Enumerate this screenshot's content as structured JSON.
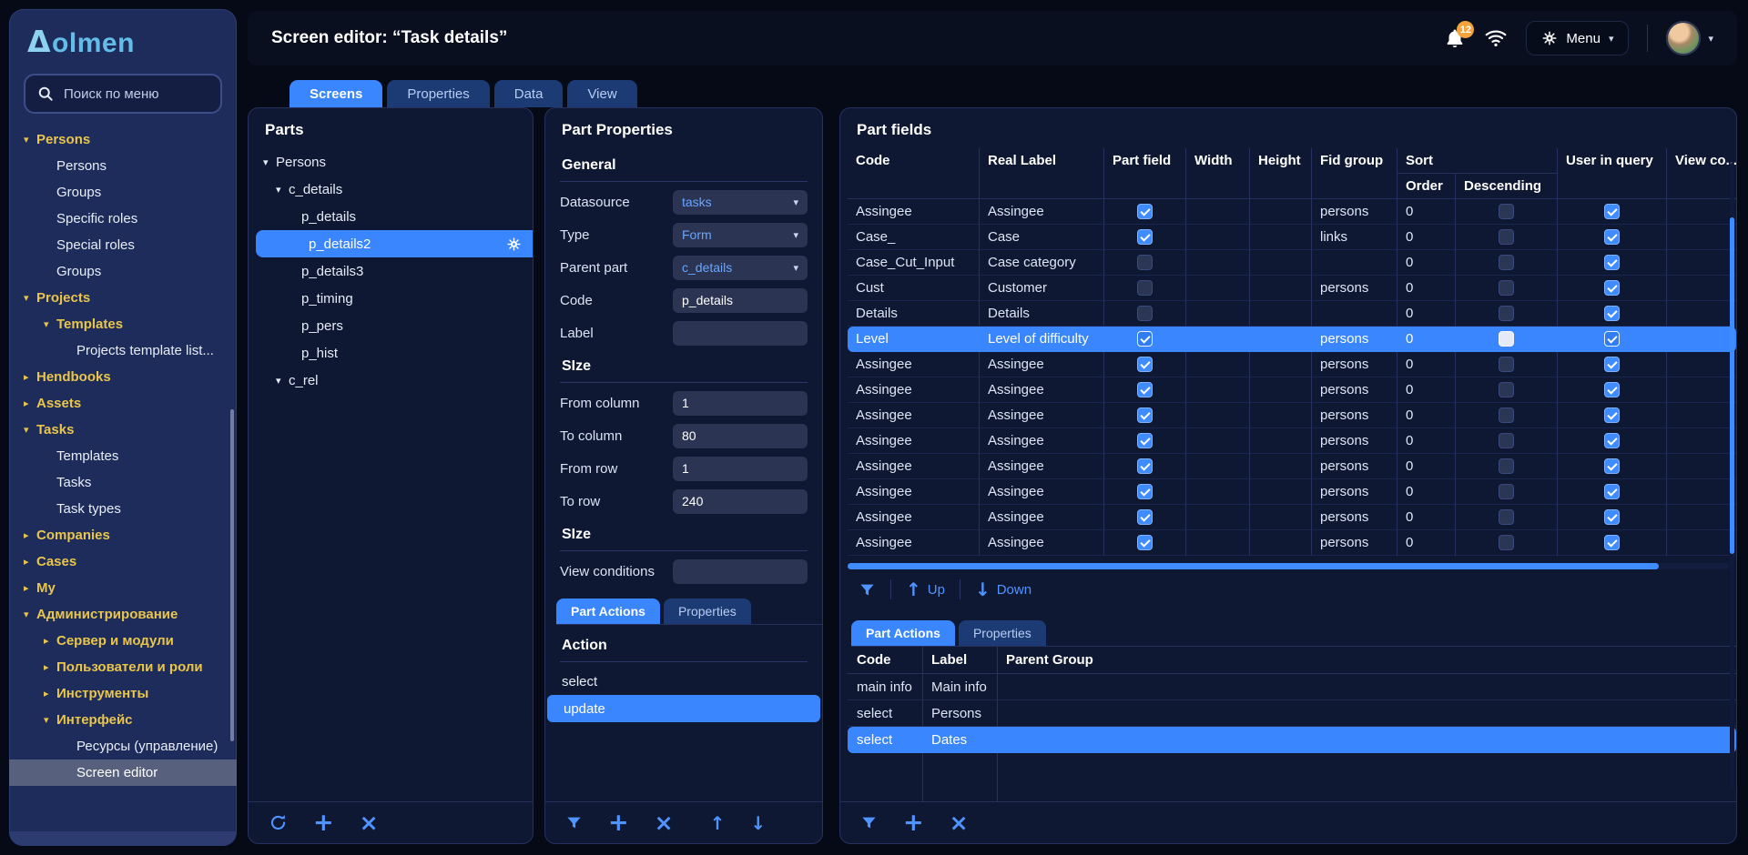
{
  "brand": {
    "delta": "Δ",
    "name": "olmen"
  },
  "icons": {
    "plus": "+",
    "close": "×",
    "up": "↑",
    "down": "↓",
    "dropdown": "▾"
  },
  "sidebar": {
    "search_placeholder": "Поиск по меню",
    "items": [
      {
        "label": "Persons",
        "caret": "▾",
        "gold": true,
        "level": 0
      },
      {
        "label": "Persons",
        "level": 1
      },
      {
        "label": "Groups",
        "level": 1
      },
      {
        "label": "Specific roles",
        "level": 1
      },
      {
        "label": "Special roles",
        "level": 1
      },
      {
        "label": "Groups",
        "level": 1
      },
      {
        "label": "Projects",
        "caret": "▾",
        "gold": true,
        "level": 0
      },
      {
        "label": "Templates",
        "caret": "▾",
        "gold": true,
        "level": 1
      },
      {
        "label": "Projects template list...",
        "level": 2
      },
      {
        "label": "Hendbooks",
        "caret": "▸",
        "gold": true,
        "level": 0
      },
      {
        "label": "Assets",
        "caret": "▸",
        "gold": true,
        "level": 0
      },
      {
        "label": "Tasks",
        "caret": "▾",
        "gold": true,
        "level": 0
      },
      {
        "label": "Templates",
        "level": 1
      },
      {
        "label": "Tasks",
        "level": 1
      },
      {
        "label": "Task types",
        "level": 1
      },
      {
        "label": "Companies",
        "caret": "▸",
        "gold": true,
        "level": 0
      },
      {
        "label": "Cases",
        "caret": "▸",
        "gold": true,
        "level": 0
      },
      {
        "label": "My",
        "caret": "▸",
        "gold": true,
        "level": 0
      },
      {
        "label": "Администрирование",
        "caret": "▾",
        "gold": true,
        "level": 0
      },
      {
        "label": "Сервер и модули",
        "caret": "▸",
        "gold": true,
        "level": 1
      },
      {
        "label": "Пользователи и роли",
        "caret": "▸",
        "gold": true,
        "level": 1
      },
      {
        "label": "Инструменты",
        "caret": "▸",
        "gold": true,
        "level": 1
      },
      {
        "label": "Интерфейс",
        "caret": "▾",
        "gold": true,
        "level": 1
      },
      {
        "label": "Ресурсы (управление)",
        "level": 2
      },
      {
        "label": "Screen editor",
        "level": 2,
        "selected": true
      }
    ]
  },
  "topbar": {
    "title": "Screen editor: “Task details”",
    "badge": "12",
    "menu_label": "Menu"
  },
  "tabs": [
    {
      "label": "Screens",
      "active": true
    },
    {
      "label": "Properties"
    },
    {
      "label": "Data"
    },
    {
      "label": "View"
    }
  ],
  "parts": {
    "title": "Parts",
    "tree": [
      {
        "label": "Persons",
        "caret": "▾",
        "level": 0
      },
      {
        "label": "c_details",
        "caret": "▾",
        "level": 1
      },
      {
        "label": "p_details",
        "level": 2
      },
      {
        "label": "p_details2",
        "level": 2,
        "selected": true,
        "gear": true
      },
      {
        "label": "p_details3",
        "level": 2
      },
      {
        "label": "p_timing",
        "level": 2
      },
      {
        "label": "p_pers",
        "level": 2
      },
      {
        "label": "p_hist",
        "level": 2
      },
      {
        "label": "c_rel",
        "caret": "▾",
        "level": 1
      }
    ]
  },
  "properties": {
    "title": "Part Properties",
    "sections": {
      "general": "General",
      "size1": "SIze",
      "size2": "SIze"
    },
    "fields": {
      "datasource": {
        "label": "Datasource",
        "value": "tasks"
      },
      "type": {
        "label": "Type",
        "value": "Form"
      },
      "parent": {
        "label": "Parent part",
        "value": "c_details"
      },
      "code": {
        "label": "Code",
        "value": "p_details"
      },
      "label": {
        "label": "Label",
        "value": ""
      },
      "from_column": {
        "label": "From column",
        "value": "1"
      },
      "to_column": {
        "label": "To column",
        "value": "80"
      },
      "from_row": {
        "label": "From row",
        "value": "1"
      },
      "to_row": {
        "label": "To row",
        "value": "240"
      },
      "view_conditions": {
        "label": "View conditions",
        "value": ""
      }
    },
    "tabs": [
      {
        "label": "Part Actions",
        "active": true
      },
      {
        "label": "Properties"
      }
    ],
    "action_header": "Action",
    "actions": [
      {
        "label": "select"
      },
      {
        "label": "update",
        "selected": true
      }
    ]
  },
  "fields": {
    "title": "Part fields",
    "columns": {
      "code": "Code",
      "real_label": "Real Label",
      "part_field": "Part field",
      "width": "Width",
      "height": "Height",
      "fid_group": "Fid group",
      "sort": "Sort",
      "order": "Order",
      "descending": "Descending",
      "user_in_query": "User in query",
      "view": "View co..."
    },
    "toolbar": {
      "up": "Up",
      "down": "Down"
    },
    "rows": [
      {
        "code": "Assingee",
        "real_label": "Assingee",
        "part_field": true,
        "width": "",
        "height": "",
        "fid_group": "persons",
        "order": "0",
        "descending": false,
        "user_in_query": true,
        "view": ""
      },
      {
        "code": "Case_",
        "real_label": "Case",
        "part_field": true,
        "width": "",
        "height": "",
        "fid_group": "links",
        "order": "0",
        "descending": false,
        "user_in_query": true,
        "view": ""
      },
      {
        "code": "Case_Cut_Input",
        "real_label": "Case category",
        "part_field": false,
        "width": "",
        "height": "",
        "fid_group": "",
        "order": "0",
        "descending": false,
        "user_in_query": true,
        "view": ""
      },
      {
        "code": "Cust",
        "real_label": "Customer",
        "part_field": false,
        "width": "",
        "height": "",
        "fid_group": "persons",
        "order": "0",
        "descending": false,
        "user_in_query": true,
        "view": ""
      },
      {
        "code": "Details",
        "real_label": "Details",
        "part_field": false,
        "width": "",
        "height": "",
        "fid_group": "",
        "order": "0",
        "descending": false,
        "user_in_query": true,
        "view": ""
      },
      {
        "code": "Level",
        "real_label": "Level of difficulty",
        "part_field": true,
        "width": "",
        "height": "",
        "fid_group": "persons",
        "order": "0",
        "descending": false,
        "user_in_query": true,
        "view": "",
        "selected": true
      },
      {
        "code": "Assingee",
        "real_label": "Assingee",
        "part_field": true,
        "width": "",
        "height": "",
        "fid_group": "persons",
        "order": "0",
        "descending": false,
        "user_in_query": true,
        "view": ""
      },
      {
        "code": "Assingee",
        "real_label": "Assingee",
        "part_field": true,
        "width": "",
        "height": "",
        "fid_group": "persons",
        "order": "0",
        "descending": false,
        "user_in_query": true,
        "view": ""
      },
      {
        "code": "Assingee",
        "real_label": "Assingee",
        "part_field": true,
        "width": "",
        "height": "",
        "fid_group": "persons",
        "order": "0",
        "descending": false,
        "user_in_query": true,
        "view": ""
      },
      {
        "code": "Assingee",
        "real_label": "Assingee",
        "part_field": true,
        "width": "",
        "height": "",
        "fid_group": "persons",
        "order": "0",
        "descending": false,
        "user_in_query": true,
        "view": ""
      },
      {
        "code": "Assingee",
        "real_label": "Assingee",
        "part_field": true,
        "width": "",
        "height": "",
        "fid_group": "persons",
        "order": "0",
        "descending": false,
        "user_in_query": true,
        "view": ""
      },
      {
        "code": "Assingee",
        "real_label": "Assingee",
        "part_field": true,
        "width": "",
        "height": "",
        "fid_group": "persons",
        "order": "0",
        "descending": false,
        "user_in_query": true,
        "view": ""
      },
      {
        "code": "Assingee",
        "real_label": "Assingee",
        "part_field": true,
        "width": "",
        "height": "",
        "fid_group": "persons",
        "order": "0",
        "descending": false,
        "user_in_query": true,
        "view": ""
      },
      {
        "code": "Assingee",
        "real_label": "Assingee",
        "part_field": true,
        "width": "",
        "height": "",
        "fid_group": "persons",
        "order": "0",
        "descending": false,
        "user_in_query": true,
        "view": ""
      }
    ]
  },
  "part_actions": {
    "tabs": [
      {
        "label": "Part Actions",
        "active": true
      },
      {
        "label": "Properties"
      }
    ],
    "columns": [
      "Code",
      "Label",
      "Parent Group"
    ],
    "rows": [
      {
        "code": "main info",
        "label": "Main info",
        "group": ""
      },
      {
        "code": "select",
        "label": "Persons",
        "group": ""
      },
      {
        "code": "select",
        "label": "Dates",
        "group": "",
        "selected": true
      }
    ]
  }
}
